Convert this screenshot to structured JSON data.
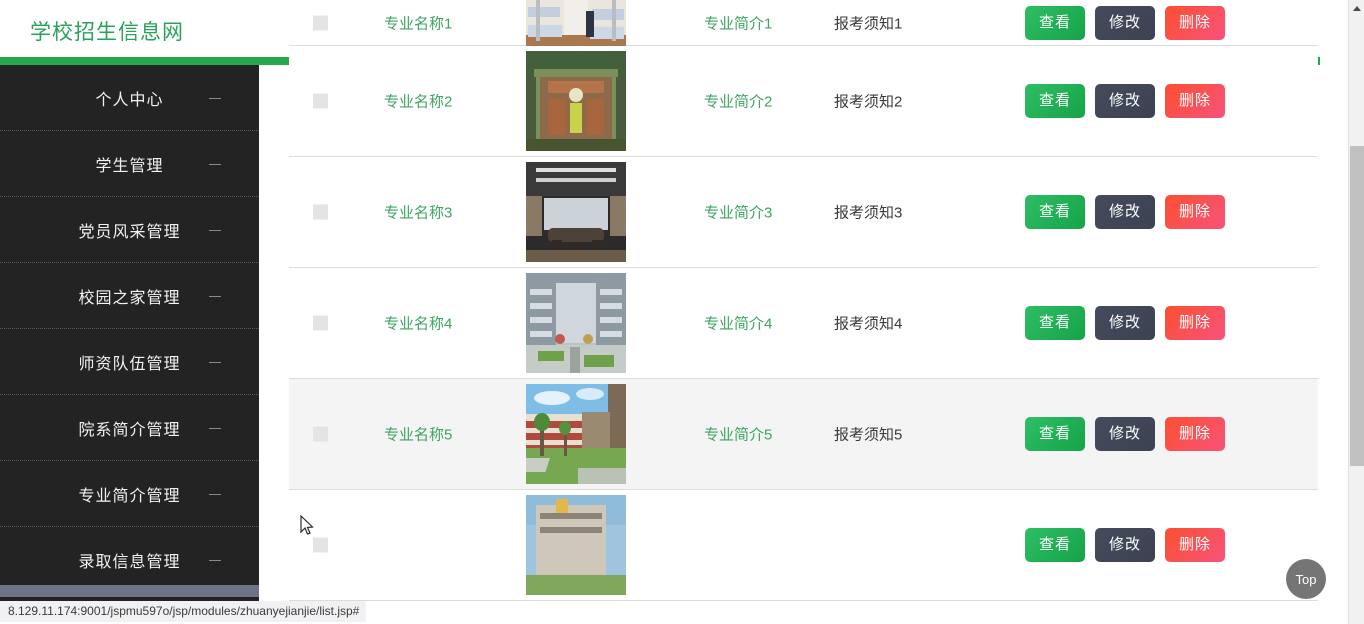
{
  "header": {
    "brand": "学校招生信息网",
    "avatar_icon": "user-avatar-icon",
    "accent_color": "#26a84e"
  },
  "sidebar": {
    "background_color": "#232323",
    "items": [
      {
        "label": "个人中心"
      },
      {
        "label": "学生管理"
      },
      {
        "label": "党员风采管理"
      },
      {
        "label": "校园之家管理"
      },
      {
        "label": "师资队伍管理"
      },
      {
        "label": "院系简介管理"
      },
      {
        "label": "专业简介管理"
      },
      {
        "label": "录取信息管理"
      }
    ]
  },
  "table": {
    "buttons": {
      "view": "查看",
      "edit": "修改",
      "delete": "删除"
    },
    "button_colors": {
      "view": "#16a34a",
      "edit": "#3c4252",
      "delete": "#fb5030"
    },
    "rows": [
      {
        "name": "专业名称1",
        "intro": "专业简介1",
        "notice": "报考须知1",
        "image_alt": "dormitory-photo",
        "hovered": false
      },
      {
        "name": "专业名称2",
        "intro": "专业简介2",
        "notice": "报考须知2",
        "image_alt": "campus-aerial-photo",
        "hovered": false
      },
      {
        "name": "专业名称3",
        "intro": "专业简介3",
        "notice": "报考须知3",
        "image_alt": "meeting-room-photo",
        "hovered": false
      },
      {
        "name": "专业名称4",
        "intro": "专业简介4",
        "notice": "报考须知4",
        "image_alt": "building-atrium-photo",
        "hovered": false
      },
      {
        "name": "专业名称5",
        "intro": "专业简介5",
        "notice": "报考须知5",
        "image_alt": "school-courtyard-photo",
        "hovered": true
      },
      {
        "name": "",
        "intro": "",
        "notice": "",
        "image_alt": "building-photo",
        "hovered": false
      }
    ]
  },
  "scroll_top_button": {
    "label": "Top"
  },
  "status_bar": {
    "url": "8.129.11.174:9001/jspmu597o/jsp/modules/zhuanyejianjie/list.jsp#"
  }
}
